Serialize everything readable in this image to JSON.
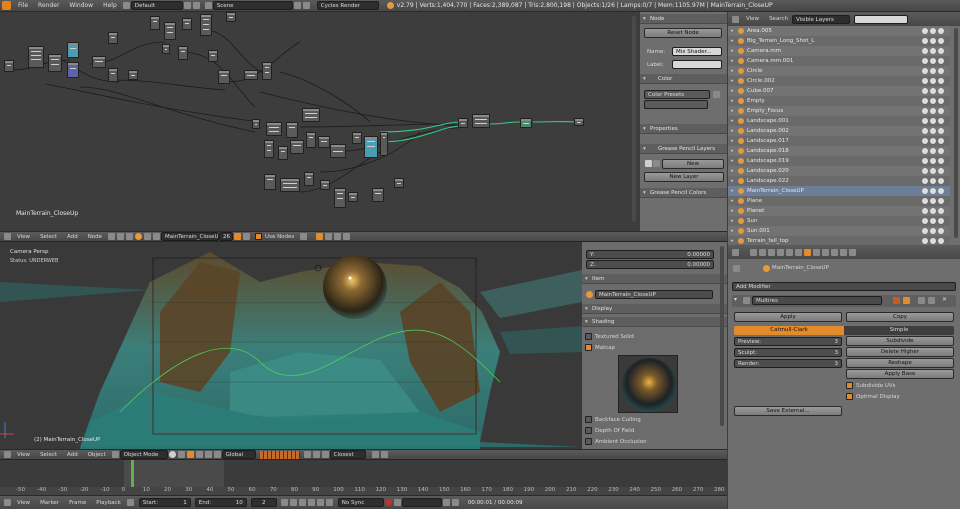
{
  "topbar": {
    "menus": [
      "File",
      "Render",
      "Window",
      "Help"
    ],
    "layout": "Default",
    "scene": "Scene",
    "engine": "Cycles Render",
    "stats": "v2.79 | Verts:1,404,770 | Faces:2,389,087 | Tris:2,800,198 | Objects:1/26 | Lamps:0/7 | Mem:1105.97M | MainTerrain_CloseUP"
  },
  "node_editor": {
    "object_label": "MainTerrain_CloseUp",
    "header": {
      "menus": [
        "View",
        "Select",
        "Add",
        "Node"
      ],
      "material": "MainTerrain_CloseUp",
      "users": "26",
      "use_nodes": "Use Nodes"
    },
    "sidebar": {
      "node_section": "Node",
      "reset_node": "Reset Node",
      "name_label": "Name:",
      "name_value": "Mix Shader...",
      "label_label": "Label:",
      "color_section": "Color",
      "color_presets": "Color Presets",
      "properties_section": "Properties",
      "grease_layers_section": "Grease Pencil Layers",
      "new_button": "New",
      "new_layer_button": "New Layer",
      "grease_colors_section": "Grease Pencil Colors"
    }
  },
  "outliner": {
    "header": {
      "menus": [
        "View",
        "Search"
      ],
      "display": "Visible Layers"
    },
    "items": [
      "Area.005",
      "Big_Terrain_Long_Shot_L",
      "Camera.mm",
      "Camera.mm.001",
      "Circle",
      "Circle.002",
      "Cube.007",
      "Empty",
      "Empty_Focus",
      "Landscape.001",
      "Landscape.002",
      "Landscape.017",
      "Landscape.018",
      "Landscape.019",
      "Landscape.020",
      "Landscape.022",
      "MainTerrain_CloseUP",
      "Plane",
      "Planet",
      "Sun",
      "Sun.001",
      "Terrain_fall_top"
    ]
  },
  "viewport": {
    "camera_label": "Camera Persp",
    "status": "Status: UNDERWEB",
    "object_label": "(2) MainTerrain_CloseUP",
    "header": {
      "menus": [
        "View",
        "Select",
        "Add",
        "Object"
      ],
      "mode": "Object Mode",
      "orientation": "Global",
      "snap": "Closest"
    },
    "npanel": {
      "y_label": "Y:",
      "y_value": "0.00000",
      "z_label": "Z:",
      "z_value": "0.00000",
      "item_section": "Item",
      "item_name": "MainTerrain_CloseUP",
      "display_section": "Display",
      "shading_section": "Shading",
      "textured_solid": "Textured Solid",
      "matcap": "Matcap",
      "backface": "Backface Culling",
      "dof": "Depth Of Field",
      "ao": "Ambient Occlusion"
    }
  },
  "properties": {
    "object_name": "MainTerrain_CloseUP",
    "add_modifier": "Add Modifier",
    "modifier_name": "Multires",
    "apply": "Apply",
    "copy": "Copy",
    "catmull": "Catmull-Clark",
    "simple": "Simple",
    "preview_label": "Preview:",
    "preview_value": "3",
    "sculpt_label": "Sculpt:",
    "sculpt_value": "3",
    "render_label": "Render:",
    "render_value": "3",
    "subdivide": "Subdivide",
    "delete_higher": "Delete Higher",
    "reshape": "Reshape",
    "apply_base": "Apply Base",
    "subdivide_uvs": "Subdivide UVs",
    "optimal_display": "Optimal Display",
    "save_external": "Save External..."
  },
  "timeline": {
    "ticks": [
      "-50",
      "-40",
      "-30",
      "-20",
      "-10",
      "0",
      "10",
      "20",
      "30",
      "40",
      "50",
      "60",
      "70",
      "80",
      "90",
      "100",
      "110",
      "120",
      "130",
      "140",
      "150",
      "160",
      "170",
      "180",
      "190",
      "200",
      "210",
      "220",
      "230",
      "240",
      "250",
      "260",
      "270",
      "280"
    ],
    "current_frame": 2,
    "menus": [
      "View",
      "Marker",
      "Frame",
      "Playback"
    ],
    "start_label": "Start:",
    "start_value": "1",
    "end_label": "End:",
    "end_value": "10",
    "frame_value": "2",
    "sync": "No Sync",
    "time": "00:00:01 / 00:00:09"
  },
  "colors": {
    "accent": "#e38a2b",
    "teal": "#2e9c9a",
    "select": "#6a8fd8"
  }
}
